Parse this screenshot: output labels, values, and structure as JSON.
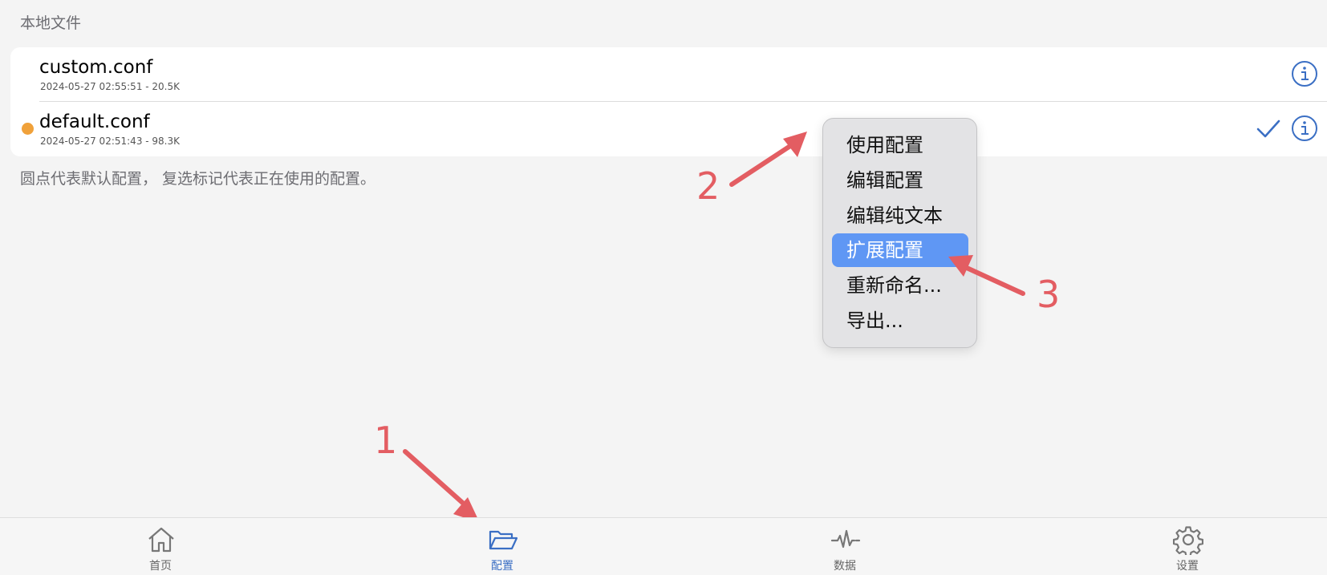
{
  "section_header": "本地文件",
  "files": [
    {
      "name": "custom.conf",
      "meta": "2024-05-27 02:55:51 - 20.5K",
      "is_default": false,
      "in_use": false
    },
    {
      "name": "default.conf",
      "meta": "2024-05-27 02:51:43 - 98.3K",
      "is_default": true,
      "in_use": true
    }
  ],
  "footer_note": "圆点代表默认配置， 复选标记代表正在使用的配置。",
  "context_menu": {
    "items": [
      "使用配置",
      "编辑配置",
      "编辑纯文本",
      "扩展配置",
      "重新命名...",
      "导出..."
    ],
    "highlighted": "扩展配置"
  },
  "annotations": [
    "1",
    "2",
    "3"
  ],
  "tabbar": {
    "tabs": [
      {
        "label": "首页",
        "icon": "house-icon"
      },
      {
        "label": "配置",
        "icon": "folder-open-icon",
        "active": true
      },
      {
        "label": "数据",
        "icon": "waveform-icon"
      },
      {
        "label": "设置",
        "icon": "gear-icon"
      }
    ]
  },
  "colors": {
    "accent": "#3b6fc4",
    "default_dot": "#f0a13a",
    "menu_highlight": "#5f97f4",
    "annotation": "#e35d62"
  }
}
